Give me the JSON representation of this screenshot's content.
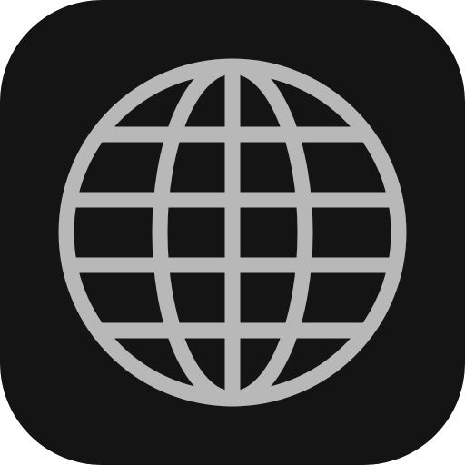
{
  "icon": {
    "name": "globe-icon",
    "colors": {
      "background": "#141414",
      "stroke": "#b8b8b8"
    }
  }
}
